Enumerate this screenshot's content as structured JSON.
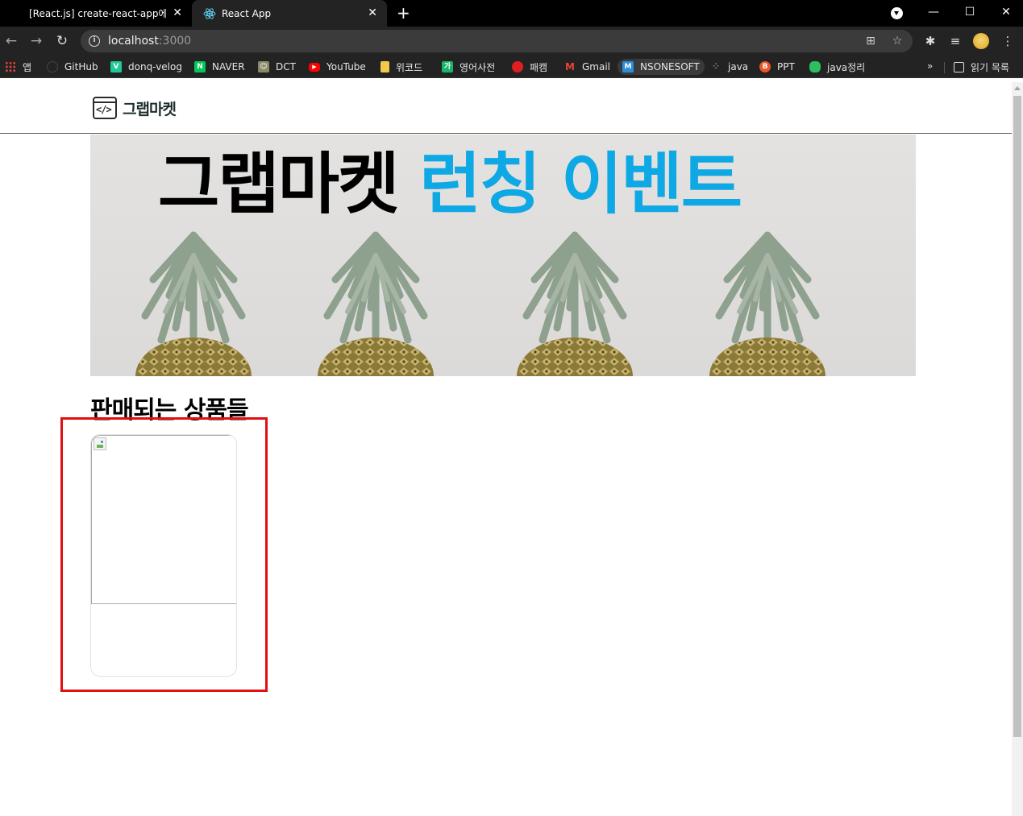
{
  "browser": {
    "tabs": [
      {
        "title": "[React.js] create-react-app에서 i",
        "active": false
      },
      {
        "title": "React App",
        "active": true
      }
    ],
    "new_tab_symbol": "+",
    "window_controls": {
      "minimize": "—",
      "maximize": "☐",
      "close": "✕"
    },
    "url": {
      "host": "localhost",
      "port": ":3000"
    },
    "bookmarks": [
      {
        "label": "앱",
        "icon": "apps-grid-icon",
        "color": "#e8453c"
      },
      {
        "label": "GitHub",
        "icon": "github-icon",
        "color": "#232323"
      },
      {
        "label": "donq-velog",
        "icon": "velog-icon",
        "color": "#20c997"
      },
      {
        "label": "NAVER",
        "icon": "naver-icon",
        "color": "#03c75a"
      },
      {
        "label": "DCT",
        "icon": "dct-icon",
        "color": "#8a8a6a"
      },
      {
        "label": "YouTube",
        "icon": "youtube-icon",
        "color": "#ff0000"
      },
      {
        "label": "위코드",
        "icon": "folder-icon",
        "color": "#f2c94c"
      },
      {
        "label": "영어사전",
        "icon": "dictionary-icon",
        "color": "#19b36a"
      },
      {
        "label": "패캠",
        "icon": "fastcampus-icon",
        "color": "#e02020"
      },
      {
        "label": "Gmail",
        "icon": "gmail-icon",
        "color": "#ea4335"
      },
      {
        "label": "NSONESOFT",
        "icon": "nsonesoft-icon",
        "color": "#2a8fd8"
      },
      {
        "label": "java",
        "icon": "java-icon",
        "color": "#6a6a6a"
      },
      {
        "label": "PPT",
        "icon": "ppt-icon",
        "color": "#e8552b"
      },
      {
        "label": "java정리",
        "icon": "evernote-icon",
        "color": "#2dbe60"
      }
    ],
    "bookmarks_more": "»",
    "reading_list": "읽기 목록"
  },
  "page": {
    "logo_text": "그랩마켓",
    "logo_mark": "</>",
    "banner": {
      "title_dark": "그랩마켓",
      "title_blue": "런칭 이벤트"
    },
    "section_title": "판매되는 상품들",
    "colors": {
      "accent_blue": "#0ea8e4",
      "highlight_red": "#e01010"
    }
  }
}
